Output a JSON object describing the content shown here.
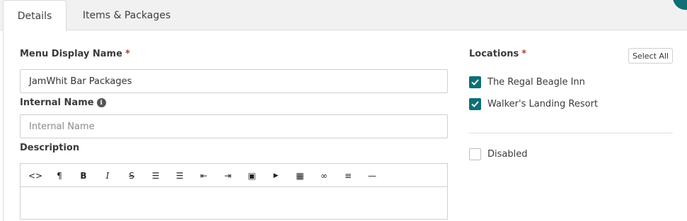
{
  "tabs": [
    {
      "label": "Details",
      "active": true
    },
    {
      "label": "Items & Packages",
      "active": false
    }
  ],
  "form": {
    "menu_display_name": {
      "label": "Menu Display Name",
      "required_mark": "*",
      "value": "JamWhit Bar Packages"
    },
    "internal_name": {
      "label": "Internal Name",
      "info_glyph": "i",
      "placeholder": "Internal Name",
      "value": ""
    },
    "description": {
      "label": "Description",
      "value": ""
    }
  },
  "editor_toolbar": [
    {
      "name": "code-view-icon",
      "glyph": "<>"
    },
    {
      "name": "paragraph-icon",
      "glyph": "¶"
    },
    {
      "name": "bold-icon",
      "glyph": "B"
    },
    {
      "name": "italic-icon",
      "glyph": "I"
    },
    {
      "name": "strikethrough-icon",
      "glyph": "S"
    },
    {
      "name": "bulleted-list-icon",
      "glyph": "☰"
    },
    {
      "name": "numbered-list-icon",
      "glyph": "☰"
    },
    {
      "name": "outdent-icon",
      "glyph": "⇤"
    },
    {
      "name": "indent-icon",
      "glyph": "⇥"
    },
    {
      "name": "image-icon",
      "glyph": "▣"
    },
    {
      "name": "video-icon",
      "glyph": "▶"
    },
    {
      "name": "table-icon",
      "glyph": "▦"
    },
    {
      "name": "link-icon",
      "glyph": "∞"
    },
    {
      "name": "align-icon",
      "glyph": "≡"
    },
    {
      "name": "horizontal-rule-icon",
      "glyph": "—"
    }
  ],
  "locations": {
    "label": "Locations",
    "required_mark": "*",
    "select_all_label": "Select All",
    "items": [
      {
        "label": "The Regal Beagle Inn",
        "checked": true
      },
      {
        "label": "Walker's Landing Resort",
        "checked": true
      }
    ]
  },
  "disabled": {
    "label": "Disabled",
    "checked": false
  },
  "colors": {
    "accent": "#0f6f74",
    "required": "#c0392b"
  }
}
